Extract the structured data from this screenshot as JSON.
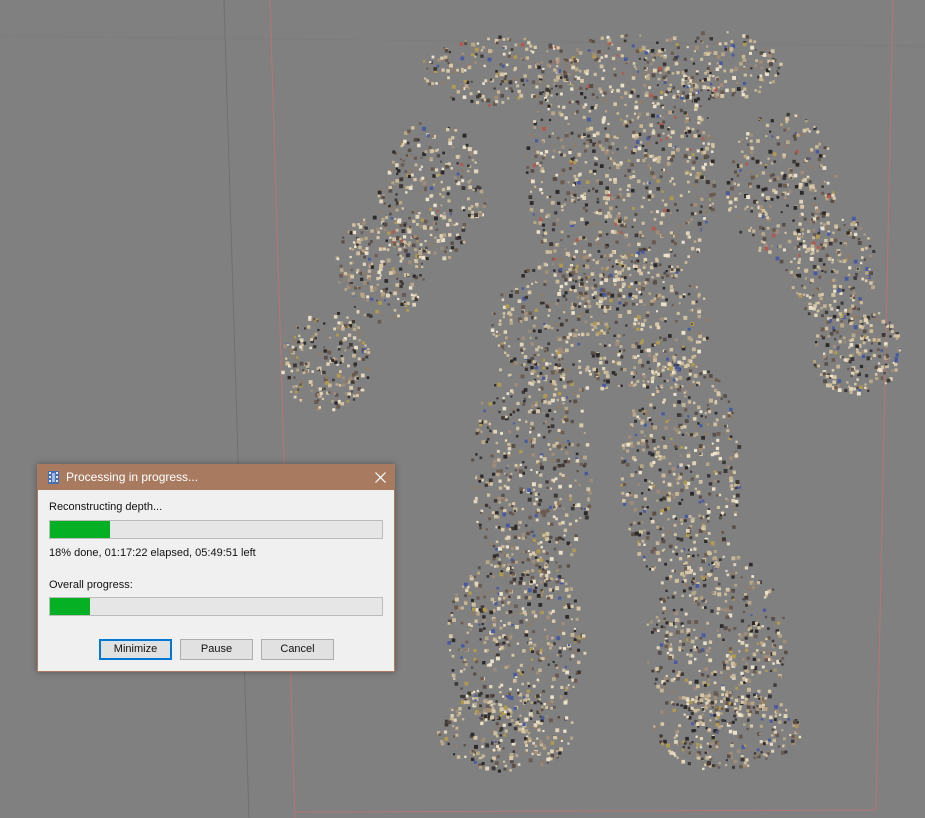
{
  "dialog": {
    "title": "Processing in progress...",
    "step_label": "Reconstructing depth...",
    "step_progress_percent": 18,
    "status_text": "18% done, 01:17:22 elapsed, 05:49:51 left",
    "overall_label": "Overall progress:",
    "overall_progress_percent": 12,
    "buttons": {
      "minimize": "Minimize",
      "pause": "Pause",
      "cancel": "Cancel"
    },
    "icons": {
      "app": "film-strip-icon",
      "close": "close-icon"
    }
  },
  "viewport": {
    "background_color": "#808080",
    "bounding_box_color": "#b07070",
    "progress_color": "#06b025",
    "titlebar_color": "#a87b61"
  }
}
